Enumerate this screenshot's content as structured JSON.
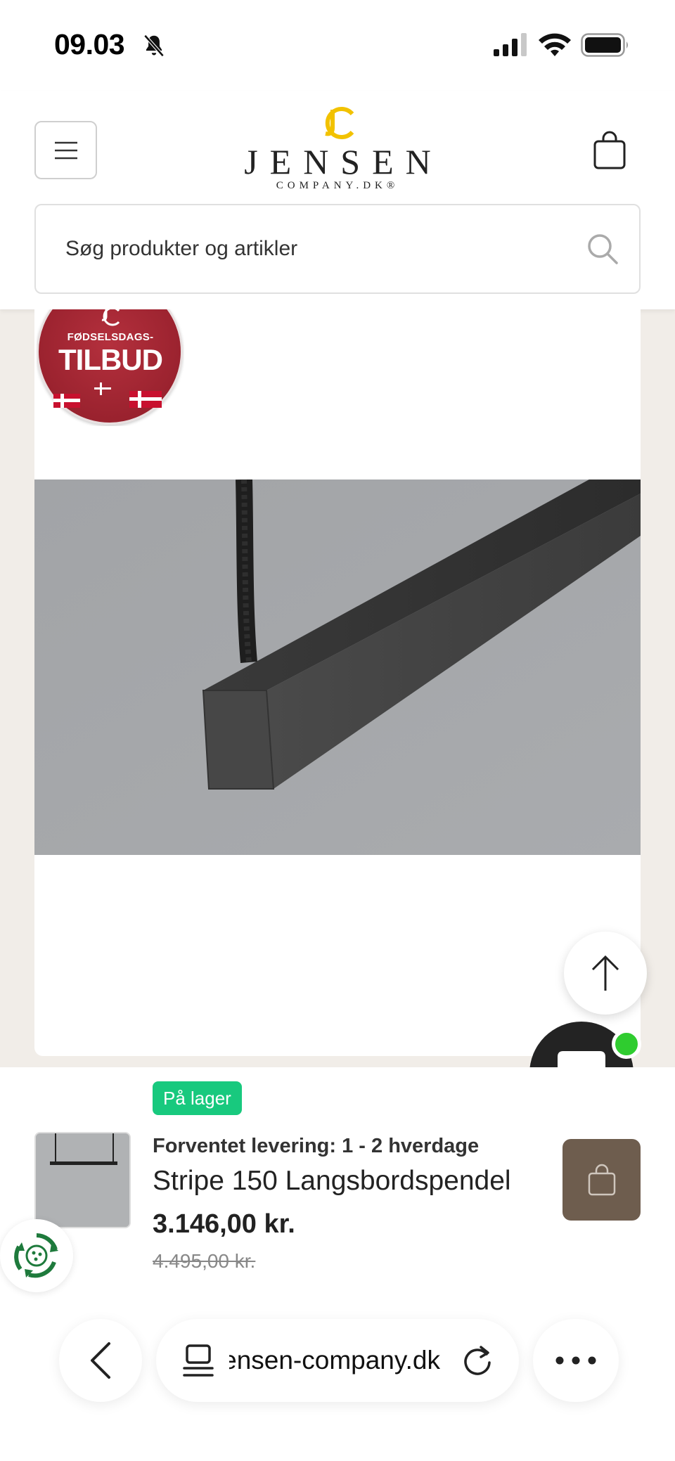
{
  "status_bar": {
    "time": "09.03"
  },
  "header": {
    "brand": {
      "name": "JENSEN",
      "sub": "COMPANY.DK®"
    },
    "search": {
      "placeholder": "Søg produkter og artikler"
    }
  },
  "product": {
    "badge": {
      "top": "FØDSELSDAGS-",
      "main": "TILBUD"
    }
  },
  "sticky_bar": {
    "stock": "På lager",
    "delivery": "Forventet levering: 1 - 2 hverdage",
    "name": "Stripe 150 Langsbordspendel",
    "price": "3.146,00 kr.",
    "old_price": "4.495,00 kr."
  },
  "browser": {
    "url": "jensen-company.dk"
  },
  "colors": {
    "stock_green": "#18c97e",
    "cart_brown": "#6e5d4e",
    "badge_red": "#a3232f",
    "logo_gold": "#f2c200",
    "chat_dot": "#2fcc2f"
  }
}
